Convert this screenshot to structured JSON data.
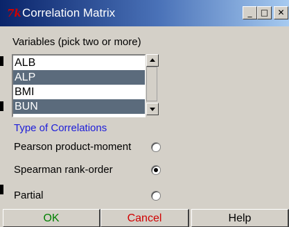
{
  "window": {
    "icon_text": "7k",
    "title": "Correlation Matrix",
    "controls": {
      "minimize": "_",
      "maximize": "□",
      "close": "✕"
    }
  },
  "variables": {
    "label": "Variables (pick two or more)",
    "items": [
      {
        "label": "ALB",
        "selected": false
      },
      {
        "label": "ALP",
        "selected": true
      },
      {
        "label": "BMI",
        "selected": false
      },
      {
        "label": "BUN",
        "selected": true
      }
    ]
  },
  "correlation_type": {
    "label": "Type of Correlations",
    "options": [
      {
        "label": "Pearson product-moment",
        "checked": false
      },
      {
        "label": "Spearman rank-order",
        "checked": true
      },
      {
        "label": "Partial",
        "checked": false
      }
    ]
  },
  "buttons": {
    "ok": "OK",
    "cancel": "Cancel",
    "help": "Help"
  },
  "colors": {
    "ok_text": "#008000",
    "cancel_text": "#d00000",
    "section_label": "#1c1cd9",
    "selection": "#5b6b7c"
  }
}
